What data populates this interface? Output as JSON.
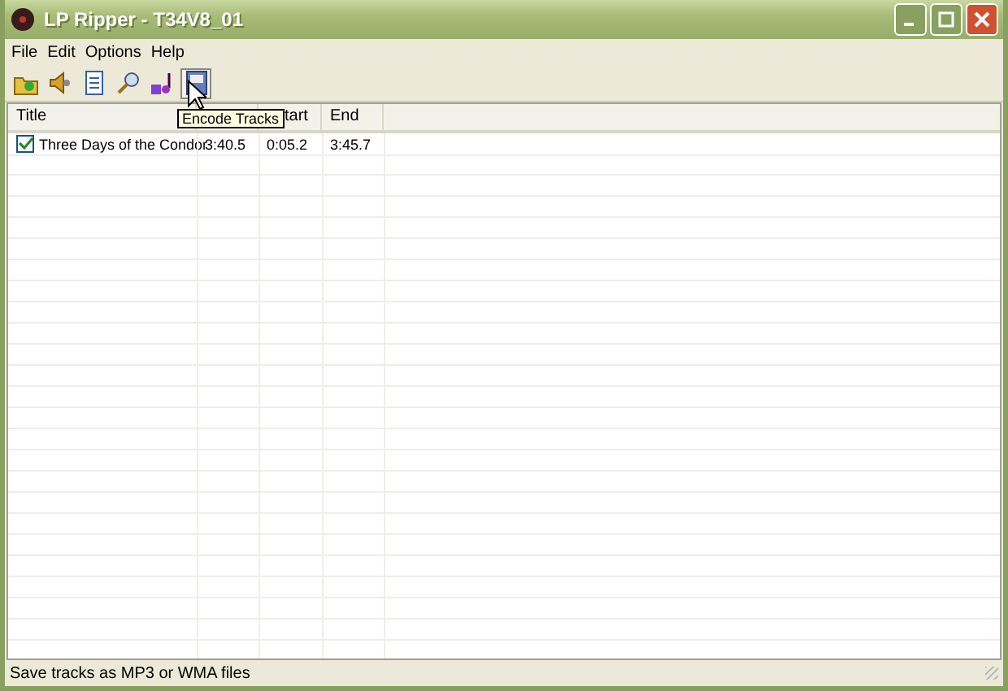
{
  "window": {
    "title": "LP Ripper - T34V8_01"
  },
  "menu": [
    "File",
    "Edit",
    "Options",
    "Help"
  ],
  "toolbar": [
    {
      "kind": "open",
      "selected": false
    },
    {
      "kind": "play",
      "selected": false
    },
    {
      "kind": "properties",
      "selected": false
    },
    {
      "kind": "find",
      "selected": false
    },
    {
      "kind": "music",
      "selected": false
    },
    {
      "kind": "encode",
      "selected": true
    }
  ],
  "tooltip": "Encode Tracks",
  "table": {
    "columns": [
      "Title",
      "",
      "tart",
      "End"
    ],
    "rows": [
      {
        "checked": true,
        "cells": [
          "Three Days of the Condor",
          "3:40.5",
          "0:05.2",
          "3:45.7"
        ]
      }
    ]
  },
  "status_bar": "Save tracks as MP3 or WMA files"
}
